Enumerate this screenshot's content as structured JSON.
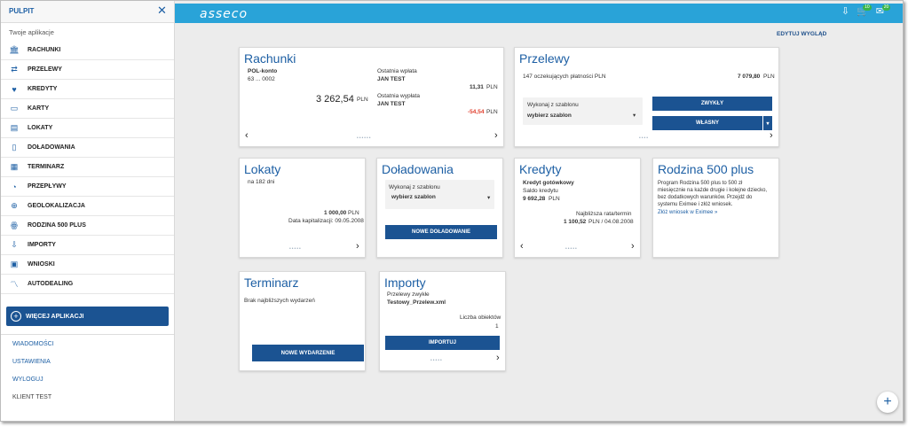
{
  "sidebar": {
    "title": "PULPIT",
    "subtitle": "Twoje aplikacje",
    "items": [
      {
        "label": "RACHUNKI",
        "icon": "bank-icon"
      },
      {
        "label": "PRZELEWY",
        "icon": "transfer-icon"
      },
      {
        "label": "KREDYTY",
        "icon": "handshake-icon"
      },
      {
        "label": "KARTY",
        "icon": "card-icon"
      },
      {
        "label": "LOKATY",
        "icon": "deposit-icon"
      },
      {
        "label": "DOŁADOWANIA",
        "icon": "phone-icon"
      },
      {
        "label": "TERMINARZ",
        "icon": "calendar-icon"
      },
      {
        "label": "PRZEPŁYWY",
        "icon": "flow-icon"
      },
      {
        "label": "GEOLOKALIZACJA",
        "icon": "globe-icon"
      },
      {
        "label": "RODZINA 500 PLUS",
        "icon": "family-icon"
      },
      {
        "label": "IMPORTY",
        "icon": "import-icon"
      },
      {
        "label": "WNIOSKI",
        "icon": "document-icon"
      },
      {
        "label": "AUTODEALING",
        "icon": "chart-icon"
      }
    ],
    "more_label": "WIĘCEJ APLIKACJI",
    "links": [
      "WIADOMOŚCI",
      "USTAWIENIA",
      "WYLOGUJ"
    ],
    "user": "KLIENT TEST"
  },
  "topbar": {
    "logo": "asseco",
    "badge_cart": "10",
    "badge_mail": "20"
  },
  "edit_view": "EDYTUJ WYGLĄD",
  "rachunki": {
    "title": "Rachunki",
    "account_name": "POL-konto",
    "account_no": "63 ... 0002",
    "balance": "3 262,54",
    "currency": "PLN",
    "last_in_label": "Ostatnia wpłata",
    "last_in_name": "JAN TEST",
    "last_in_amount": "11,31",
    "last_out_label": "Ostatnia wypłata",
    "last_out_name": "JAN TEST",
    "last_out_amount": "-54,54"
  },
  "przelewy": {
    "title": "Przelewy",
    "pending": "147 oczekujących płatności PLN",
    "pending_amount": "7 079,80",
    "currency": "PLN",
    "template_label": "Wykonaj z szablonu",
    "template_value": "wybierz szablon",
    "btn_normal": "ZWYKŁY",
    "btn_own": "WŁASNY"
  },
  "lokaty": {
    "title": "Lokaty",
    "period": "na 182 dni",
    "amount": "1 000,00",
    "currency": "PLN",
    "cap_date": "Data kapitalizacji: 09.05.2008"
  },
  "doladowania": {
    "title": "Doładowania",
    "template_label": "Wykonaj z szablonu",
    "template_value": "wybierz szablon",
    "btn_new": "NOWE DOŁADOWANIE"
  },
  "kredyty": {
    "title": "Kredyty",
    "name": "Kredyt gotówkowy",
    "balance_label": "Saldo kredytu",
    "balance": "9 692,28",
    "currency": "PLN",
    "next_label": "Najbliższa rata/termin",
    "next_amount": "1 100,52",
    "next_tail": "PLN / 04.08.2008"
  },
  "rodzina": {
    "title": "Rodzina 500 plus",
    "text": [
      "Program Rodzina 500 plus to 500 zł",
      "miesięcznie na każde drugie i kolejne dziecko,",
      "bez dodatkowych warunków. Przejdź do",
      "systemu Eximee i złóż wniosek."
    ],
    "link": "Złóż wniosek w Eximee »"
  },
  "terminarz": {
    "title": "Terminarz",
    "empty": "Brak najbliższych wydarzeń",
    "btn_new": "NOWE WYDARZENIE"
  },
  "importy": {
    "title": "Importy",
    "type": "Przelewy zwykłe",
    "file": "Testowy_Przelew.xml",
    "count_label": "Liczba obiektów",
    "count": "1",
    "btn_import": "IMPORTUJ"
  },
  "colors": {
    "accent": "#1b5392",
    "topbar": "#29a3d8",
    "negative": "#e0402f"
  }
}
